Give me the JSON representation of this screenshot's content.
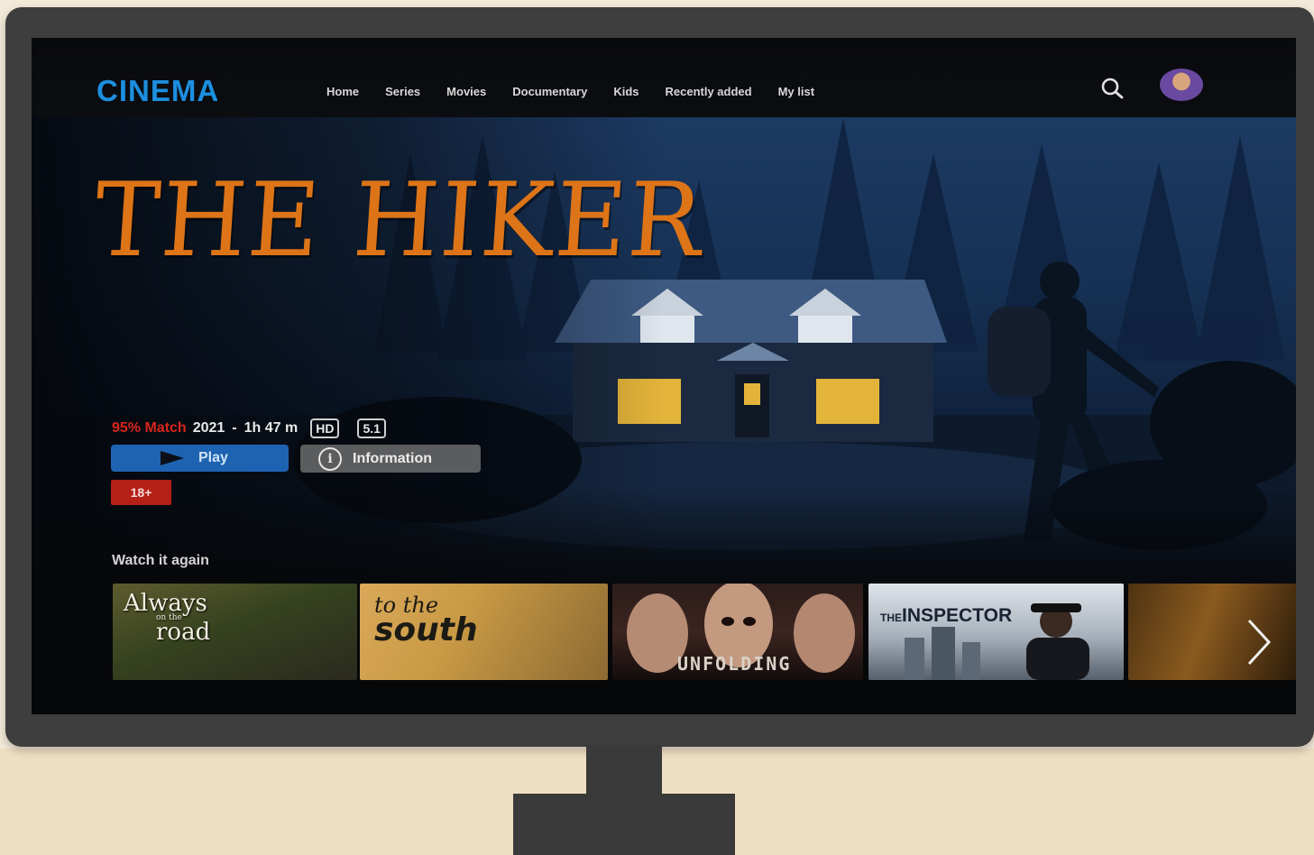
{
  "nav": {
    "brand": "CINEMA",
    "items": [
      "Home",
      "Series",
      "Movies",
      "Documentary",
      "Kids",
      "Recently added",
      "My list"
    ]
  },
  "hero": {
    "title": "THE HIKER",
    "match": "95% Match",
    "year": "2021",
    "separator": "-",
    "duration": "1h 47 m",
    "tags": [
      "HD",
      "5.1"
    ],
    "play_label": "Play",
    "info_label": "Information",
    "info_icon": "i",
    "age_rating": "18+"
  },
  "row": {
    "title": "Watch it again",
    "thumbnails": [
      {
        "title_main": "Always",
        "title_small": "on the",
        "title_end": "road"
      },
      {
        "title_line1": "to the",
        "title_line2": "south"
      },
      {
        "title": "UNFOLDING"
      },
      {
        "title_the": "THE",
        "title_rest": "INSPECTOR"
      },
      {
        "title": ""
      }
    ]
  },
  "colors": {
    "brand": "#1c8fe0",
    "title": "#dd7418",
    "match": "#d7251b",
    "play_button": "#1e63b2",
    "age_badge": "#b52016"
  }
}
